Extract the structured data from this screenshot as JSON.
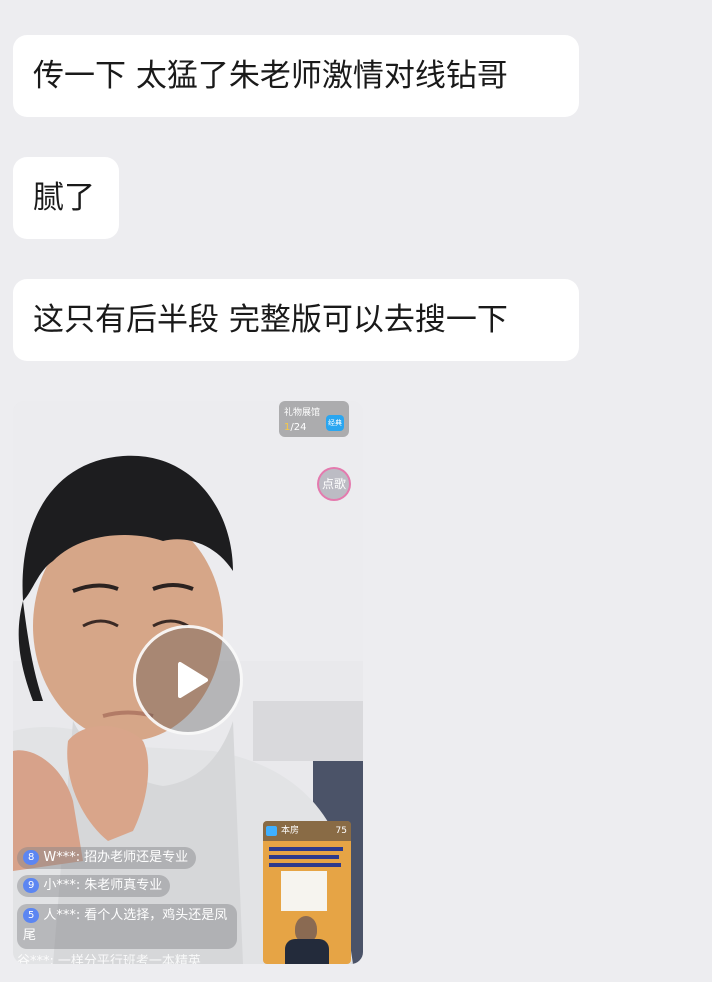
{
  "messages": [
    {
      "text": "传一下 太猛了朱老师激情对线钻哥"
    },
    {
      "text": "腻了"
    },
    {
      "text": "这只有后半段 完整版可以去搜一下"
    }
  ],
  "video": {
    "gift_hall": {
      "label": "礼物展馆",
      "count_highlight": "1",
      "count_rest": "/24",
      "badge": "经典"
    },
    "song_button": "点歌",
    "comments": [
      {
        "level": "8",
        "user": "W***:",
        "text": "招办老师还是专业"
      },
      {
        "level": "9",
        "user": "小***:",
        "text": "朱老师真专业"
      },
      {
        "level": "5",
        "user": "人***:",
        "text": "看个人选择，鸡头还是凤尾"
      },
      {
        "user": "谷***:",
        "text": "一样分平行班考一本精英"
      }
    ],
    "pip": {
      "room": "本房",
      "count": "75"
    }
  }
}
